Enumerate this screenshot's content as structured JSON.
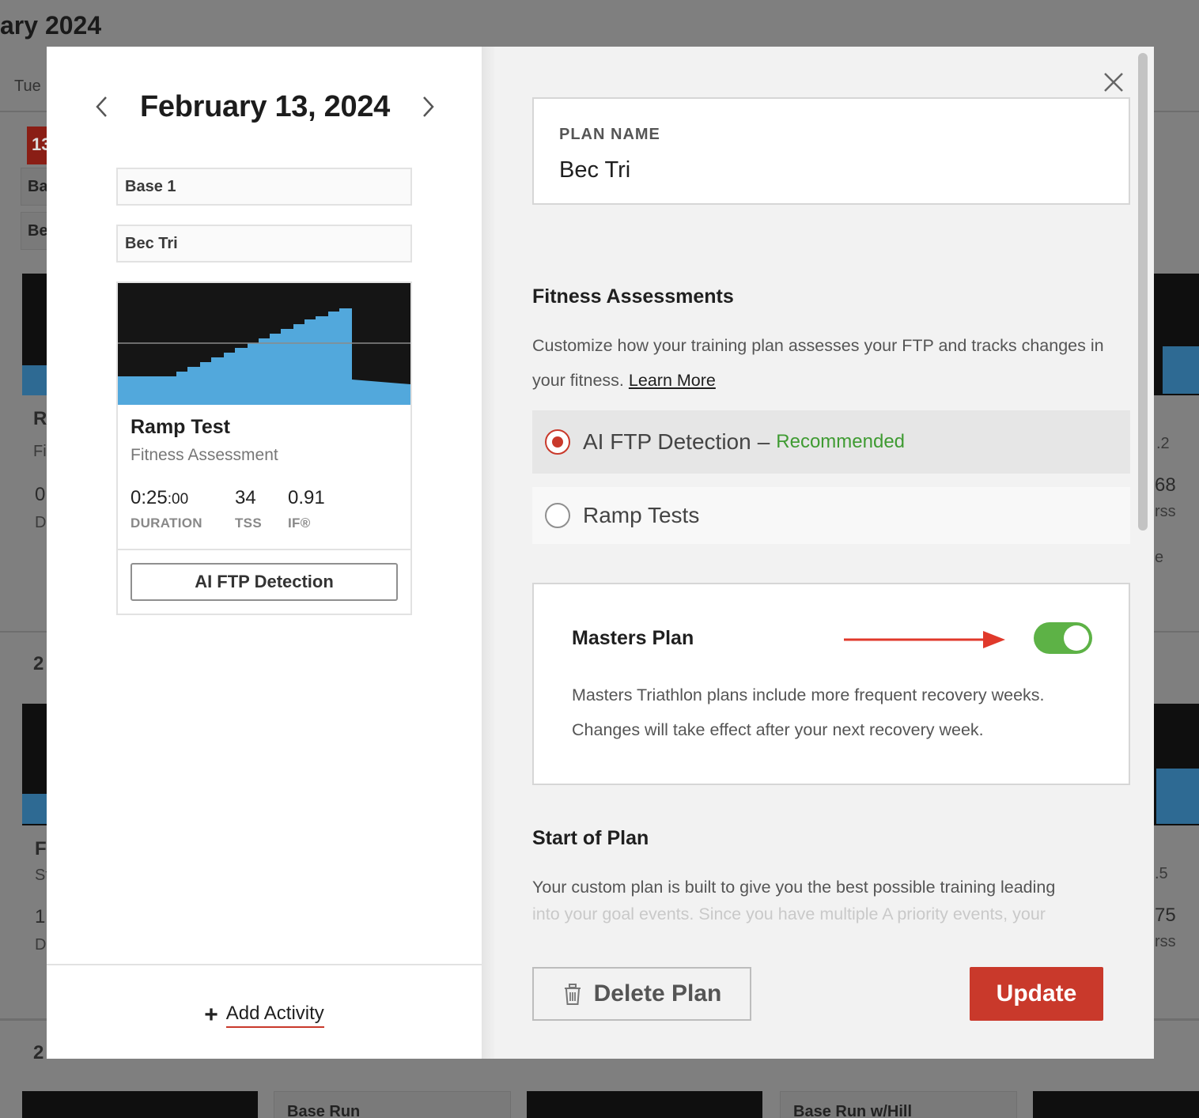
{
  "background": {
    "month_title": "ary 2024",
    "day_label": "Tue",
    "date_badge": "13",
    "snippets": [
      "Ba",
      "Be",
      "R",
      "Fi",
      "0",
      "D",
      "2",
      "F",
      "St",
      "1:",
      "D",
      "2",
      ".2",
      "68",
      "rss",
      "e",
      ".5",
      "75",
      "rss",
      "Base Run",
      "Base Run w/Hill"
    ]
  },
  "left_panel": {
    "date_title": "February 13, 2024",
    "phase_tag": "Base 1",
    "plan_tag": "Bec Tri",
    "workout": {
      "name": "Ramp Test",
      "type": "Fitness Assessment",
      "stats": [
        {
          "value": "0:25",
          "value_small": ":00",
          "label": "DURATION"
        },
        {
          "value": "34",
          "value_small": "",
          "label": "TSS"
        },
        {
          "value": "0.91",
          "value_small": "",
          "label": "IF®"
        }
      ],
      "action_label": "AI FTP Detection"
    },
    "add_activity_label": "Add Activity"
  },
  "right_panel": {
    "plan_name_label": "PLAN NAME",
    "plan_name_value": "Bec Tri",
    "fitness_title": "Fitness Assessments",
    "fitness_desc": "Customize how your training plan assesses your FTP and tracks changes in your fitness.",
    "learn_more": "Learn More",
    "options": [
      {
        "label": "AI FTP Detection",
        "dash": "–",
        "badge": "Recommended",
        "selected": true
      },
      {
        "label": "Ramp Tests",
        "selected": false
      }
    ],
    "masters_title": "Masters Plan",
    "masters_enabled": true,
    "masters_desc": "Masters Triathlon plans include more frequent recovery weeks. Changes will take effect after your next recovery week.",
    "start_title": "Start of Plan",
    "start_desc": "Your custom plan is built to give you the best possible training leading",
    "start_desc_faded": "into your goal events. Since you have multiple A priority events, your",
    "delete_label": "Delete Plan",
    "update_label": "Update"
  },
  "colors": {
    "accent_red": "#c9392b",
    "toggle_green": "#5db246",
    "recommended_green": "#3f9b32",
    "workout_blue": "#52a8dc"
  },
  "icons": [
    "chevron-left-icon",
    "chevron-right-icon",
    "close-icon",
    "plus-icon",
    "trash-icon",
    "arrow-right-icon"
  ]
}
